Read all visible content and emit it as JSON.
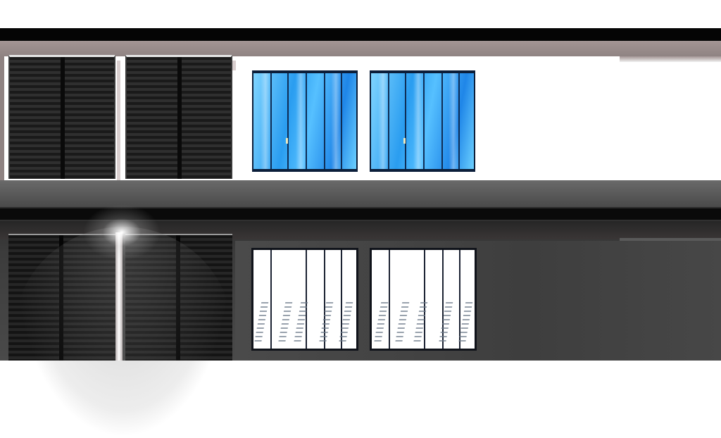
{
  "scene": {
    "type": "building facade texture atlas",
    "colors": {
      "glass": "#2a9df0",
      "trim": "#a39594",
      "shutter": "#151515",
      "bar": "#050505"
    },
    "top_panel": {
      "shutters": 2,
      "windows": 2,
      "panes_per_window": 6
    },
    "bottom_panel": {
      "shutters": 2,
      "windows": 2,
      "panes_per_window": 6,
      "light_flare": true
    }
  }
}
